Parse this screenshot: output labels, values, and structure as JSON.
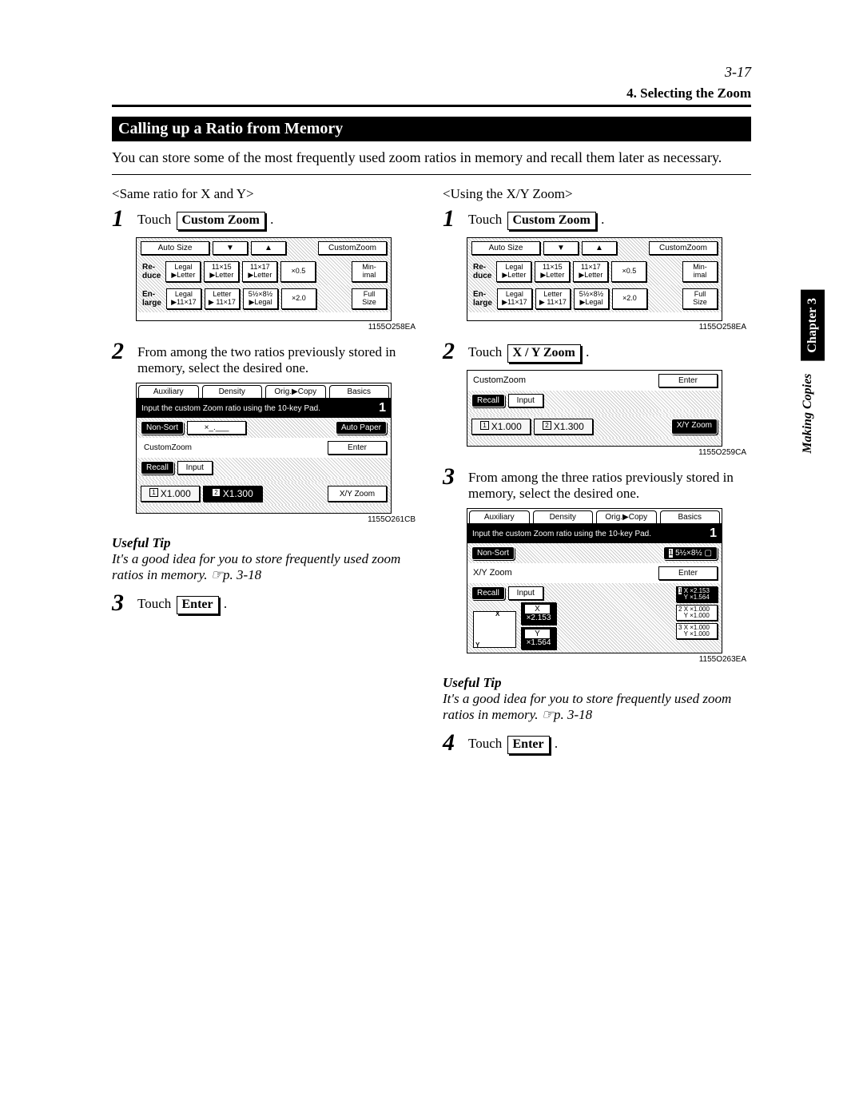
{
  "page": {
    "pagenum": "3-17",
    "section": "4. Selecting the Zoom",
    "title": "Calling up a Ratio from Memory",
    "intro": "You can store some of the most frequently used zoom ratios in memory and recall them later as necessary."
  },
  "left": {
    "sub": "<Same ratio for X and Y>",
    "s1_touch": "Touch",
    "s1_btn": "Custom Zoom",
    "s2_text": "From among the two ratios previously stored in memory, select the desired one.",
    "tip_h": "Useful Tip",
    "tip": "It's a good idea for you to store frequently used zoom ratios in memory. ☞p. 3-18",
    "s3_touch": "Touch",
    "s3_btn": "Enter",
    "img1": "1155O258EA",
    "img2": "1155O261CB"
  },
  "right": {
    "sub": "<Using the X/Y Zoom>",
    "s1_touch": "Touch",
    "s1_btn": "Custom Zoom",
    "s2_touch": "Touch",
    "s2_btn": "X / Y Zoom",
    "s3_text": "From among the three ratios previously stored in memory, select the desired one.",
    "tip_h": "Useful Tip",
    "tip": "It's a good idea for you to store frequently used zoom ratios in memory. ☞p. 3-18",
    "s4_touch": "Touch",
    "s4_btn": "Enter",
    "img1": "1155O258EA",
    "img2": "1155O259CA",
    "img3": "1155O263EA"
  },
  "sidetab": {
    "chapter": "Chapter 3",
    "making": "Making Copies"
  },
  "panelA": {
    "autosize": "Auto Size",
    "customzoom": "CustomZoom",
    "reduce": "Re-\nduce",
    "enlarge": "En-\nlarge",
    "r1": "Legal\n▶Letter",
    "r2": "11×15\n▶Letter",
    "r3": "11×17\n▶Letter",
    "r4": "×0.5",
    "r5": "Min-\nimal",
    "e1": "Legal\n▶11×17",
    "e2": "Letter\n▶ 11×17",
    "e3": "5½×8½\n▶Legal",
    "e4": "×2.0",
    "e5": "Full\nSize"
  },
  "panelB": {
    "tab1": "Auxiliary",
    "tab2": "Density",
    "tab3": "Orig.▶Copy",
    "tab4": "Basics",
    "msg": "Input the custom Zoom ratio using the 10-key Pad.",
    "big": "1",
    "nonsort": "Non-Sort",
    "xblank": "×_.___",
    "autopaper": "Auto Paper",
    "customzoom": "CustomZoom",
    "enter": "Enter",
    "recall": "Recall",
    "input": "Input",
    "m1": "X1.000",
    "m2": "X1.300",
    "xyzoom": "X/Y Zoom"
  },
  "panelC": {
    "customzoom": "CustomZoom",
    "enter": "Enter",
    "recall": "Recall",
    "input": "Input",
    "m1": "X1.000",
    "m2": "X1.300",
    "xyzoom": "X/Y Zoom"
  },
  "panelD": {
    "tab1": "Auxiliary",
    "tab2": "Density",
    "tab3": "Orig.▶Copy",
    "tab4": "Basics",
    "msg": "Input the custom Zoom ratio using the 10-key Pad.",
    "big": "1",
    "nonsort": "Non-Sort",
    "paper": "5½×8½ ▢",
    "xyzoom": "X/Y Zoom",
    "enter": "Enter",
    "recall": "Recall",
    "input": "Input",
    "xlbl": "X",
    "ylbl": "Y",
    "xv": "×2.153",
    "yv": "×1.564",
    "p1a": "X ×2.153",
    "p1b": "Y ×1.564",
    "p2a": "X ×1.000",
    "p2b": "Y ×1.000",
    "p3a": "X ×1.000",
    "p3b": "Y ×1.000"
  }
}
